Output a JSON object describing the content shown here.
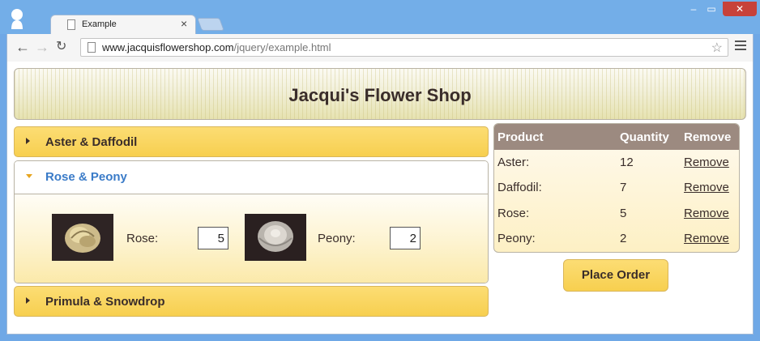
{
  "browser": {
    "tab_title": "Example",
    "tab_close": "×",
    "url_host": "www.jacquisflowershop.com",
    "url_path": "/jquery/example.html",
    "window_controls": {
      "minimize": "‒",
      "maximize": "▭",
      "close": "✕"
    },
    "nav": {
      "back": "←",
      "forward": "→",
      "reload": "↻"
    },
    "star": "☆"
  },
  "page": {
    "title": "Jacqui's Flower Shop",
    "accordion": [
      {
        "label": "Aster & Daffodil",
        "expanded": false
      },
      {
        "label": "Rose & Peony",
        "expanded": true,
        "products": [
          {
            "label": "Rose:",
            "value": "5"
          },
          {
            "label": "Peony:",
            "value": "2"
          }
        ]
      },
      {
        "label": "Primula & Snowdrop",
        "expanded": false
      }
    ],
    "cart": {
      "headers": [
        "Product",
        "Quantity",
        "Remove"
      ],
      "rows": [
        {
          "product": "Aster:",
          "quantity": "12",
          "remove": "Remove"
        },
        {
          "product": "Daffodil:",
          "quantity": "7",
          "remove": "Remove"
        },
        {
          "product": "Rose:",
          "quantity": "5",
          "remove": "Remove"
        },
        {
          "product": "Peony:",
          "quantity": "2",
          "remove": "Remove"
        }
      ]
    },
    "order_button": "Place Order"
  },
  "colors": {
    "accent_gold": "#f7cf4f",
    "header_brown": "#9c8a80",
    "link_blue": "#3a7bc8",
    "close_red": "#c7423a"
  }
}
